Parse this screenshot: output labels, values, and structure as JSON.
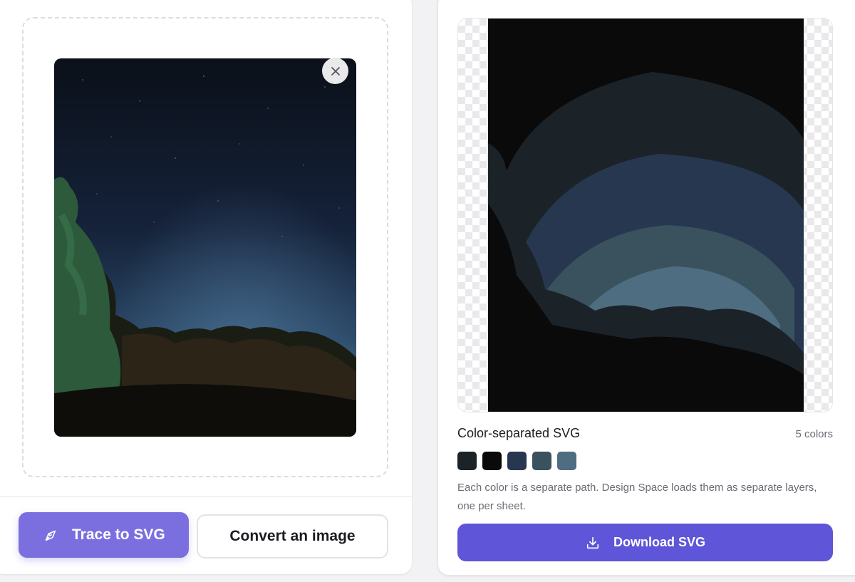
{
  "upload": {
    "close_icon": "close-icon"
  },
  "actions": {
    "trace_label": "Trace to SVG",
    "trace_icon": "pen-tool-icon",
    "convert_label": "Convert an image"
  },
  "result": {
    "title": "Color-separated SVG",
    "color_count": "5 colors",
    "palette": [
      "#1b2329",
      "#0a0a0b",
      "#283750",
      "#39525d",
      "#4e6d80"
    ],
    "description": "Each color is a separate path. Design Space loads them as separate layers, one per sheet.",
    "download_label": "Download SVG",
    "download_icon": "download-icon"
  }
}
